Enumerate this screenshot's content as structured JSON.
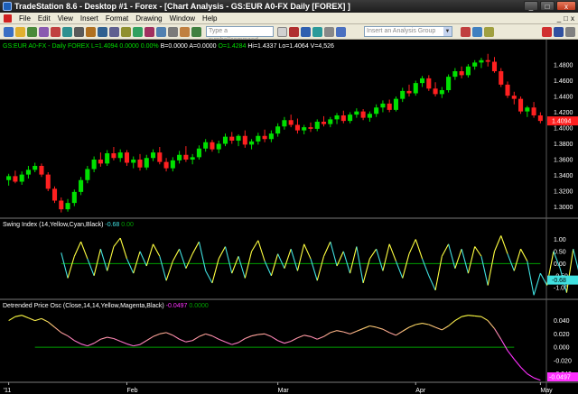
{
  "window": {
    "title": "TradeStation 8.6 - Desktop #1 - Forex - [Chart Analysis - GS:EUR A0-FX Daily [FOREX] ]",
    "buttons": [
      "_",
      "□",
      "x"
    ]
  },
  "menu": {
    "items": [
      "File",
      "Edit",
      "View",
      "Insert",
      "Format",
      "Drawing",
      "Window",
      "Help"
    ],
    "mdi_buttons": [
      "_",
      "□",
      "x"
    ]
  },
  "toolbar": {
    "symbol_placeholder": "Type a symbol/command",
    "analysis_placeholder": "Insert an Analysis Group"
  },
  "colors": {
    "bull": "#00e000",
    "bear": "#ff2020",
    "yellow": "#ffff40",
    "cyan": "#40e0e0",
    "magenta": "#ff30ff",
    "green_line": "#00a000"
  },
  "price_panel": {
    "header": {
      "symbol": "GS:EUR A0-FX - Daily",
      "exchange": "FOREX",
      "last": "L=1.4094",
      "change": "0.0000",
      "pct": "0.00%",
      "bid": "B=0.0000",
      "ask": "A=0.0000",
      "open": "O=1.4284",
      "high": "Hi=1.4337",
      "low": "Lo=1.4064",
      "volume": "V=4,526"
    },
    "axis_labels": [
      "1.4800",
      "1.4600",
      "1.4400",
      "1.4200",
      "1.4000",
      "1.3800",
      "1.3600",
      "1.3400",
      "1.3200",
      "1.3000"
    ],
    "last_price_tag": "1.4094"
  },
  "swing_panel": {
    "header": {
      "name": "Swing Index (14,Yellow,Cyan,Black)",
      "value1": "-0.68",
      "value2": "0.00"
    },
    "axis_labels": [
      "1.00",
      "0.50",
      "0.00",
      "-0.50",
      "-1.00"
    ],
    "last_value_tag": "-0.68"
  },
  "dpo_panel": {
    "header": {
      "name": "Detrended Price Osc (Close,14,14,Yellow,Magenta,Black)",
      "value1": "-0.0497",
      "value2": "0.0000"
    },
    "axis_labels": [
      "0.040",
      "0.020",
      "0.000",
      "-0.020",
      "-0.040"
    ],
    "last_value_tag": "-0.0497"
  },
  "x_axis": {
    "labels": [
      "'11",
      "Feb",
      "Mar",
      "Apr",
      "May"
    ]
  },
  "chart_data": {
    "type": "candlestick",
    "y_range_price": [
      1.288,
      1.496
    ],
    "candles": [
      [
        1.334,
        1.342,
        1.327,
        1.339
      ],
      [
        1.339,
        1.346,
        1.33,
        1.332
      ],
      [
        1.332,
        1.345,
        1.328,
        1.341
      ],
      [
        1.341,
        1.352,
        1.336,
        1.347
      ],
      [
        1.347,
        1.356,
        1.344,
        1.352
      ],
      [
        1.352,
        1.355,
        1.338,
        1.341
      ],
      [
        1.341,
        1.344,
        1.32,
        1.323
      ],
      [
        1.323,
        1.326,
        1.305,
        1.308
      ],
      [
        1.308,
        1.312,
        1.293,
        1.297
      ],
      [
        1.297,
        1.31,
        1.294,
        1.305
      ],
      [
        1.305,
        1.322,
        1.301,
        1.319
      ],
      [
        1.319,
        1.338,
        1.315,
        1.334
      ],
      [
        1.334,
        1.352,
        1.33,
        1.348
      ],
      [
        1.348,
        1.364,
        1.344,
        1.36
      ],
      [
        1.36,
        1.369,
        1.351,
        1.355
      ],
      [
        1.355,
        1.372,
        1.352,
        1.368
      ],
      [
        1.368,
        1.376,
        1.359,
        1.362
      ],
      [
        1.362,
        1.373,
        1.357,
        1.369
      ],
      [
        1.369,
        1.372,
        1.352,
        1.356
      ],
      [
        1.356,
        1.364,
        1.349,
        1.36
      ],
      [
        1.36,
        1.367,
        1.346,
        1.35
      ],
      [
        1.35,
        1.366,
        1.347,
        1.362
      ],
      [
        1.362,
        1.373,
        1.358,
        1.369
      ],
      [
        1.369,
        1.376,
        1.354,
        1.357
      ],
      [
        1.357,
        1.362,
        1.345,
        1.349
      ],
      [
        1.349,
        1.363,
        1.345,
        1.359
      ],
      [
        1.359,
        1.371,
        1.355,
        1.366
      ],
      [
        1.366,
        1.377,
        1.357,
        1.36
      ],
      [
        1.36,
        1.367,
        1.354,
        1.363
      ],
      [
        1.363,
        1.378,
        1.36,
        1.374
      ],
      [
        1.374,
        1.386,
        1.37,
        1.382
      ],
      [
        1.382,
        1.385,
        1.37,
        1.373
      ],
      [
        1.373,
        1.384,
        1.368,
        1.38
      ],
      [
        1.38,
        1.393,
        1.377,
        1.389
      ],
      [
        1.389,
        1.395,
        1.38,
        1.384
      ],
      [
        1.384,
        1.392,
        1.377,
        1.39
      ],
      [
        1.39,
        1.397,
        1.375,
        1.379
      ],
      [
        1.379,
        1.386,
        1.373,
        1.383
      ],
      [
        1.383,
        1.394,
        1.379,
        1.39
      ],
      [
        1.39,
        1.398,
        1.382,
        1.386
      ],
      [
        1.386,
        1.397,
        1.382,
        1.393
      ],
      [
        1.393,
        1.406,
        1.389,
        1.402
      ],
      [
        1.402,
        1.414,
        1.398,
        1.41
      ],
      [
        1.41,
        1.417,
        1.401,
        1.404
      ],
      [
        1.404,
        1.412,
        1.393,
        1.397
      ],
      [
        1.397,
        1.404,
        1.392,
        1.401
      ],
      [
        1.401,
        1.407,
        1.395,
        1.399
      ],
      [
        1.399,
        1.411,
        1.396,
        1.408
      ],
      [
        1.408,
        1.415,
        1.402,
        1.405
      ],
      [
        1.405,
        1.414,
        1.401,
        1.411
      ],
      [
        1.411,
        1.419,
        1.405,
        1.416
      ],
      [
        1.416,
        1.422,
        1.406,
        1.409
      ],
      [
        1.409,
        1.42,
        1.406,
        1.417
      ],
      [
        1.417,
        1.425,
        1.413,
        1.421
      ],
      [
        1.421,
        1.424,
        1.41,
        1.413
      ],
      [
        1.413,
        1.421,
        1.408,
        1.418
      ],
      [
        1.418,
        1.43,
        1.414,
        1.426
      ],
      [
        1.426,
        1.435,
        1.42,
        1.431
      ],
      [
        1.431,
        1.436,
        1.42,
        1.423
      ],
      [
        1.423,
        1.44,
        1.421,
        1.437
      ],
      [
        1.437,
        1.451,
        1.433,
        1.447
      ],
      [
        1.447,
        1.455,
        1.44,
        1.444
      ],
      [
        1.444,
        1.46,
        1.441,
        1.457
      ],
      [
        1.457,
        1.466,
        1.452,
        1.463
      ],
      [
        1.463,
        1.467,
        1.447,
        1.45
      ],
      [
        1.45,
        1.458,
        1.44,
        1.443
      ],
      [
        1.443,
        1.452,
        1.438,
        1.448
      ],
      [
        1.448,
        1.468,
        1.445,
        1.465
      ],
      [
        1.465,
        1.476,
        1.461,
        1.472
      ],
      [
        1.472,
        1.478,
        1.463,
        1.467
      ],
      [
        1.467,
        1.481,
        1.464,
        1.478
      ],
      [
        1.478,
        1.486,
        1.474,
        1.483
      ],
      [
        1.483,
        1.489,
        1.476,
        1.486
      ],
      [
        1.486,
        1.494,
        1.478,
        1.484
      ],
      [
        1.484,
        1.49,
        1.47,
        1.472
      ],
      [
        1.472,
        1.476,
        1.452,
        1.455
      ],
      [
        1.455,
        1.459,
        1.438,
        1.441
      ],
      [
        1.441,
        1.446,
        1.43,
        1.437
      ],
      [
        1.437,
        1.44,
        1.418,
        1.421
      ],
      [
        1.421,
        1.428,
        1.414,
        1.426
      ],
      [
        1.426,
        1.433,
        1.413,
        1.416
      ],
      [
        1.416,
        1.42,
        1.406,
        1.409
      ]
    ],
    "swing_index": [
      0.45,
      -0.6,
      0.3,
      0.9,
      0.2,
      -0.5,
      0.6,
      -0.3,
      0.7,
      1.05,
      0.2,
      -0.4,
      0.5,
      -0.1,
      0.8,
      0.3,
      -0.7,
      0.1,
      0.6,
      -0.2,
      0.4,
      0.9,
      -0.3,
      -0.8,
      0.2,
      0.7,
      -0.4,
      0.3,
      -0.6,
      0.5,
      0.95,
      0.1,
      -0.5,
      0.4,
      -0.2,
      0.6,
      -0.3,
      0.8,
      0.2,
      -0.7,
      0.3,
      0.9,
      -0.1,
      0.5,
      -0.4,
      0.7,
      -0.8,
      0.2,
      0.6,
      -0.3,
      0.8,
      0.1,
      -0.6,
      0.4,
      1.0,
      0.2,
      -0.5,
      -1.1,
      0.3,
      0.8,
      -0.2,
      0.6,
      -0.4,
      0.7,
      0.3,
      -0.9,
      0.5,
      1.15,
      0.4,
      -0.3,
      0.6,
      0.1,
      -1.3,
      -0.4,
      -0.9,
      0.5,
      -0.2,
      -1.2,
      0.6,
      -0.5,
      0.0,
      -0.68
    ],
    "swing_range": [
      -1.4,
      1.35
    ],
    "dpo": [
      0.04,
      0.046,
      0.048,
      0.044,
      0.04,
      0.043,
      0.038,
      0.03,
      0.022,
      0.017,
      0.01,
      0.005,
      0.002,
      0.006,
      0.012,
      0.015,
      0.013,
      0.009,
      0.005,
      0.002,
      0.004,
      0.01,
      0.016,
      0.02,
      0.022,
      0.018,
      0.012,
      0.008,
      0.01,
      0.016,
      0.02,
      0.017,
      0.012,
      0.008,
      0.004,
      0.007,
      0.013,
      0.017,
      0.019,
      0.02,
      0.016,
      0.01,
      0.006,
      0.009,
      0.014,
      0.018,
      0.016,
      0.012,
      0.016,
      0.022,
      0.025,
      0.023,
      0.02,
      0.024,
      0.028,
      0.032,
      0.03,
      0.027,
      0.022,
      0.018,
      0.024,
      0.03,
      0.034,
      0.036,
      0.034,
      0.03,
      0.026,
      0.032,
      0.04,
      0.046,
      0.048,
      0.047,
      0.046,
      0.04,
      0.028,
      0.012,
      -0.005,
      -0.018,
      -0.03,
      -0.04,
      -0.046,
      -0.0497
    ],
    "dpo_range": [
      -0.05,
      0.053
    ],
    "dpo_zero_line": 0.0
  }
}
